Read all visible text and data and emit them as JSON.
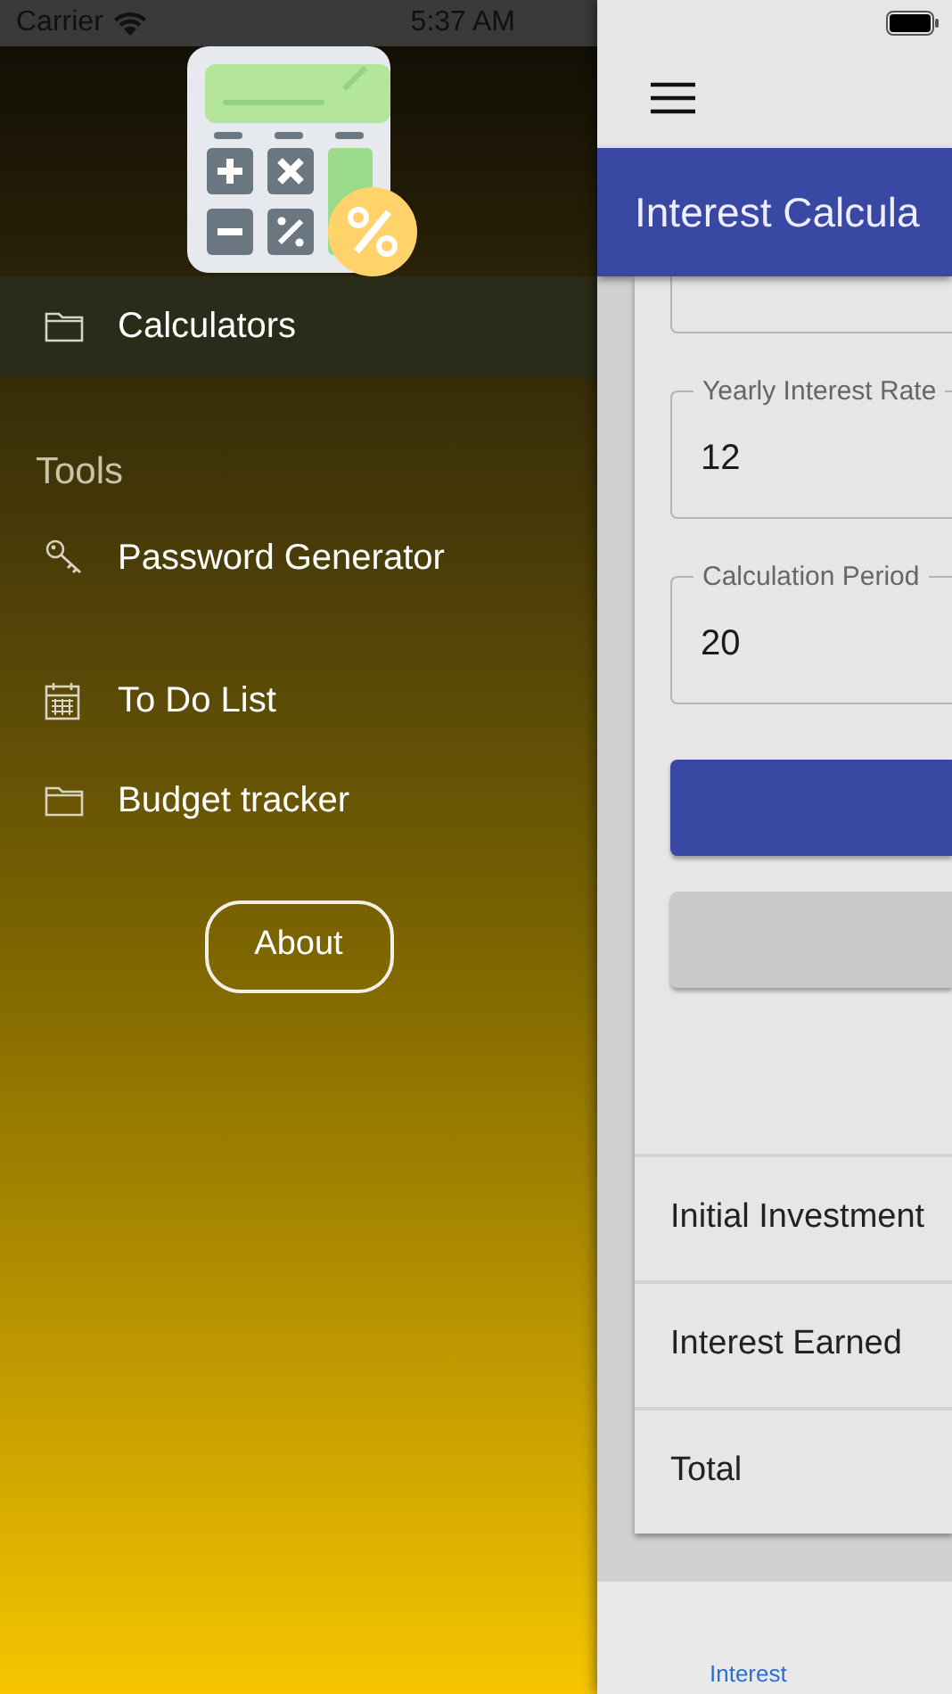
{
  "status_bar": {
    "carrier": "Carrier",
    "time": "5:37 AM"
  },
  "drawer": {
    "sections": [
      {
        "items": [
          {
            "label": "Calculators",
            "kind": "folder",
            "selected": true
          }
        ]
      },
      {
        "title": "Tools",
        "items": [
          {
            "label": "Password Generator",
            "kind": "key",
            "selected": false
          },
          {
            "label": "To Do List",
            "kind": "calendar",
            "selected": false
          },
          {
            "label": "Budget tracker",
            "kind": "folder",
            "selected": false
          }
        ]
      }
    ],
    "about_button": "About"
  },
  "main": {
    "header_title": "Interest Calcula",
    "fields": [
      {
        "label": "Yearly Interest Rate",
        "value": "12"
      },
      {
        "label": "Calculation Period",
        "value": "20"
      }
    ],
    "buttons": [
      {
        "kind": "primary"
      },
      {
        "kind": "secondary"
      }
    ],
    "results": [
      "Initial Investment",
      "Interest Earned",
      "Total"
    ],
    "tab_bar": [
      {
        "label": "Interest",
        "selected": true
      }
    ]
  }
}
